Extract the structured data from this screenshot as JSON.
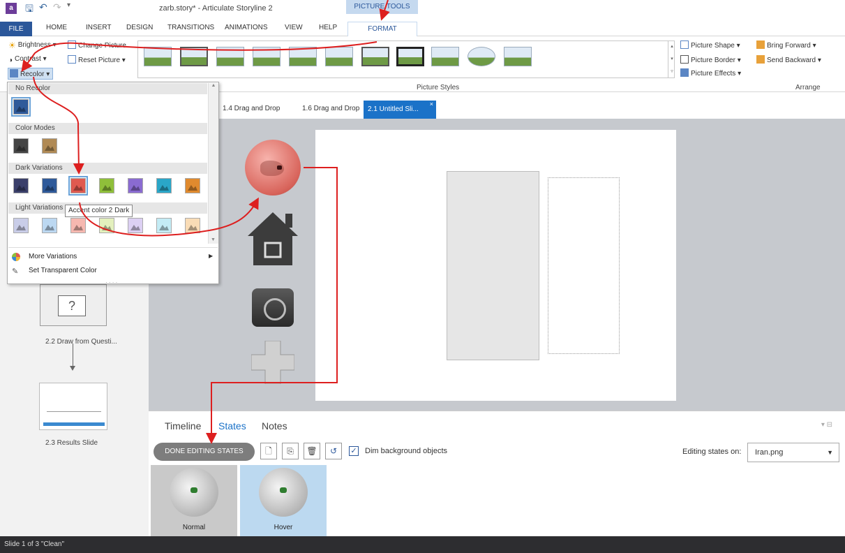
{
  "window": {
    "title": "zarb.story* - Articulate Storyline 2",
    "context_group": "PICTURE TOOLS"
  },
  "tabs": [
    "FILE",
    "HOME",
    "INSERT",
    "DESIGN",
    "TRANSITIONS",
    "ANIMATIONS",
    "VIEW",
    "HELP",
    "FORMAT"
  ],
  "ribbon": {
    "brightness": "Brightness",
    "contrast": "Contrast",
    "recolor": "Recolor",
    "change_picture": "Change Picture",
    "reset_picture": "Reset Picture",
    "picture_styles_label": "Picture Styles",
    "picture_shape": "Picture Shape",
    "picture_border": "Picture Border",
    "picture_effects": "Picture Effects",
    "bring_forward": "Bring Forward",
    "send_backward": "Send Backward",
    "arrange_label": "Arrange"
  },
  "recolor_menu": {
    "no_recolor": "No Recolor",
    "color_modes": "Color Modes",
    "dark_variations": "Dark Variations",
    "light_variations": "Light Variations",
    "tooltip": "Accent color 2 Dark",
    "more_variations": "More Variations",
    "set_transparent": "Set Transparent Color",
    "dark_colors": [
      "#3a3f6a",
      "#2f5a9a",
      "#e05a4f",
      "#8fbf3a",
      "#8a6bd1",
      "#2aa6c8",
      "#e08a2e"
    ],
    "light_colors": [
      "#c9cde8",
      "#bcd8f1",
      "#f6b8b0",
      "#e3f0bd",
      "#dcd0f3",
      "#c4ecf5",
      "#f9dcb6"
    ],
    "mode_colors": [
      "#444444",
      "#b08a55"
    ]
  },
  "slide_tabs": [
    "1.4 Drag and Drop",
    "1.6 Drag and Drop",
    "2.1 Untitled Sli..."
  ],
  "left_panel": {
    "thumb_label_q": "2.2 Draw from Questi...",
    "thumb_label_r": "2.3 Results Slide"
  },
  "bottom": {
    "tab_timeline": "Timeline",
    "tab_states": "States",
    "tab_notes": "Notes",
    "done_button": "DONE EDITING STATES",
    "dim_label": "Dim background objects",
    "editing_label": "Editing states on:",
    "editing_value": "Iran.png",
    "states": [
      "Normal",
      "Hover"
    ]
  },
  "status": {
    "text": "Slide 1 of 3   \"Clean\""
  },
  "colors": {
    "accent": "#2b579a",
    "selected_tab": "#1b72c8",
    "arrow": "#dd1f1f",
    "hover_state_bg": "#bcd9f0"
  }
}
